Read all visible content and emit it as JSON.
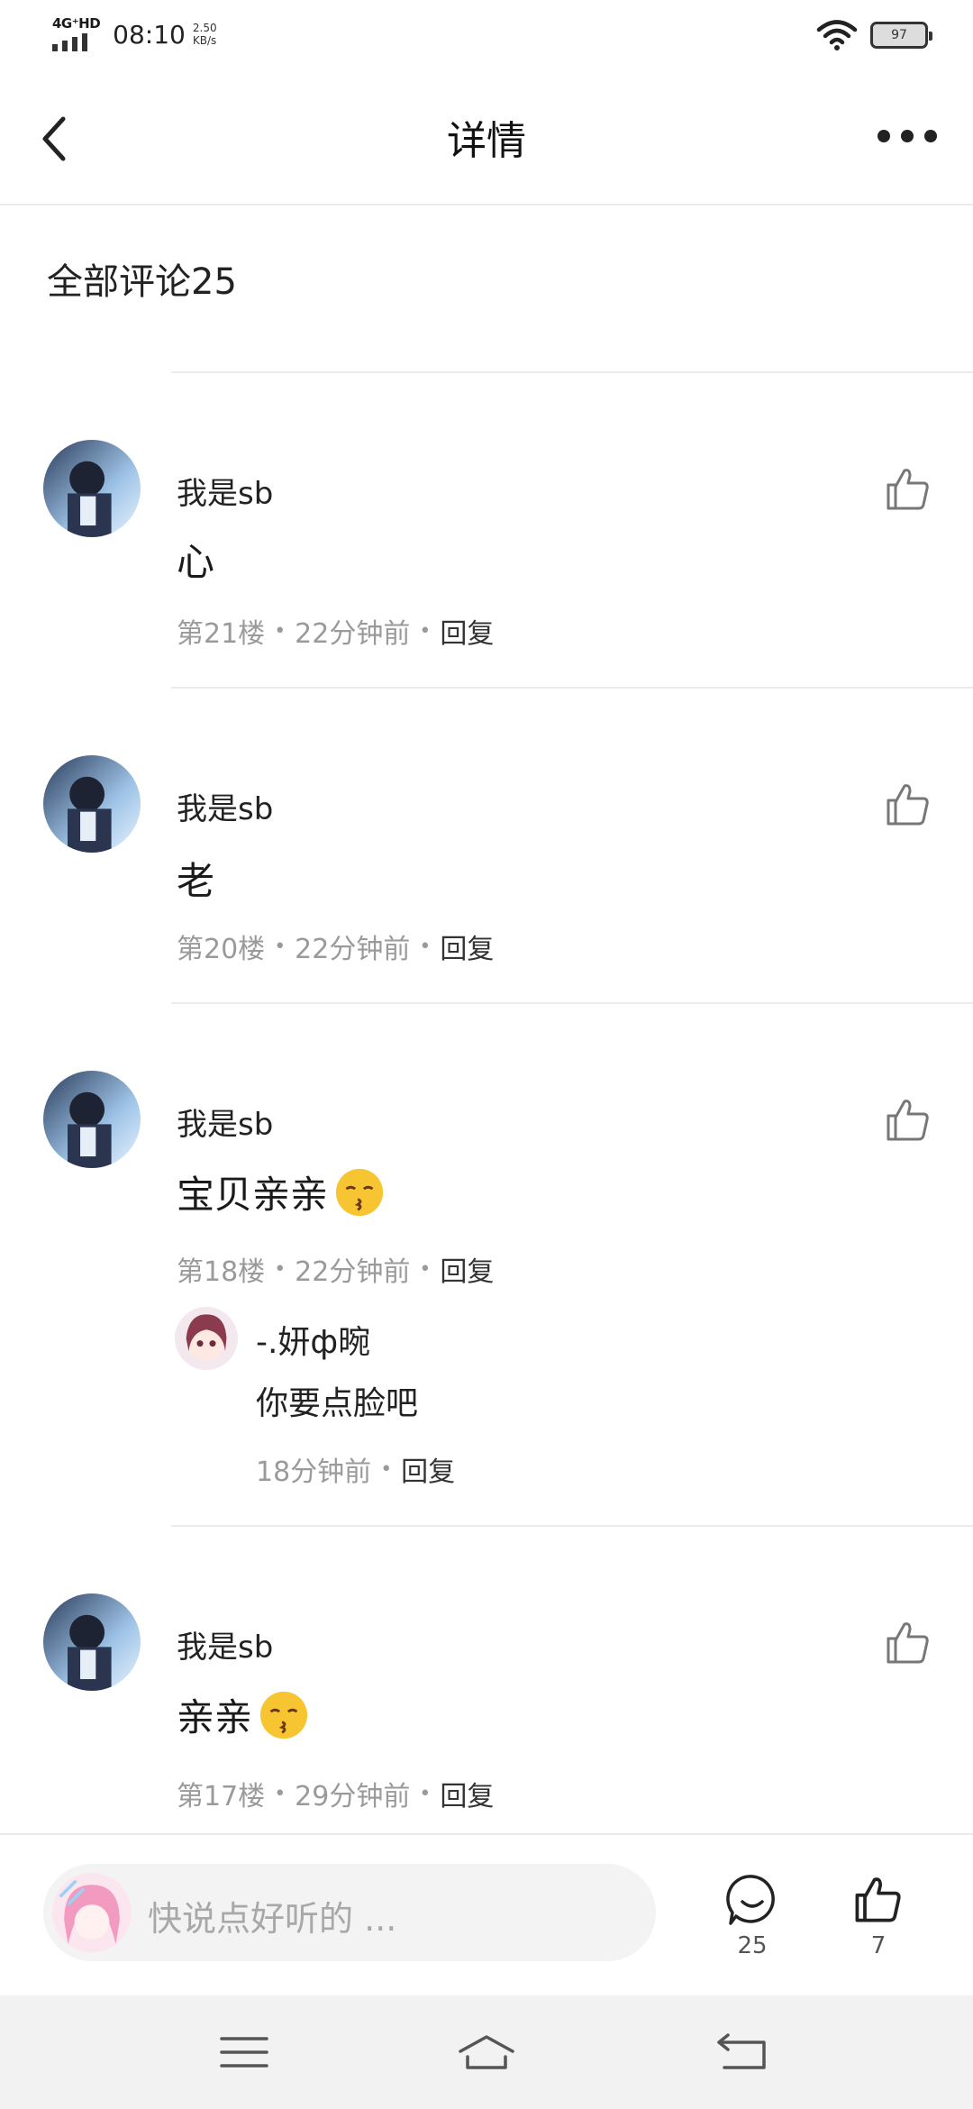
{
  "status_bar": {
    "network": "4G⁺HD",
    "time": "08:10",
    "speed_value": "2.50",
    "speed_unit": "KB/s",
    "battery": "97"
  },
  "header": {
    "title": "详情",
    "back_icon": "chevron-left-icon",
    "more_icon": "more-dots-icon"
  },
  "section": {
    "all_comments_label": "全部评论25"
  },
  "comments": [
    {
      "name": "我是sb",
      "text": "心",
      "floor": "第21楼",
      "time": "22分钟前",
      "reply": "回复"
    },
    {
      "name": "我是sb",
      "text": "老",
      "floor": "第20楼",
      "time": "22分钟前",
      "reply": "回复"
    },
    {
      "name": "我是sb",
      "text": "宝贝亲亲",
      "floor": "第18楼",
      "time": "22分钟前",
      "reply": "回复",
      "sub_reply": {
        "name": "-.妍ф晼",
        "text": "你要点脸吧",
        "time": "18分钟前",
        "reply": "回复"
      }
    },
    {
      "name": "我是sb",
      "text": "亲亲",
      "floor": "第17楼",
      "time": "29分钟前",
      "reply": "回复"
    }
  ],
  "bottom_bar": {
    "placeholder": "快说点好听的 ...",
    "comment_count": "25",
    "like_count": "7"
  },
  "colors": {
    "divider": "#ececec",
    "meta_gray": "#9a9a9a",
    "input_bg": "#f3f3f3",
    "nav_bg": "#f2f2f2"
  }
}
